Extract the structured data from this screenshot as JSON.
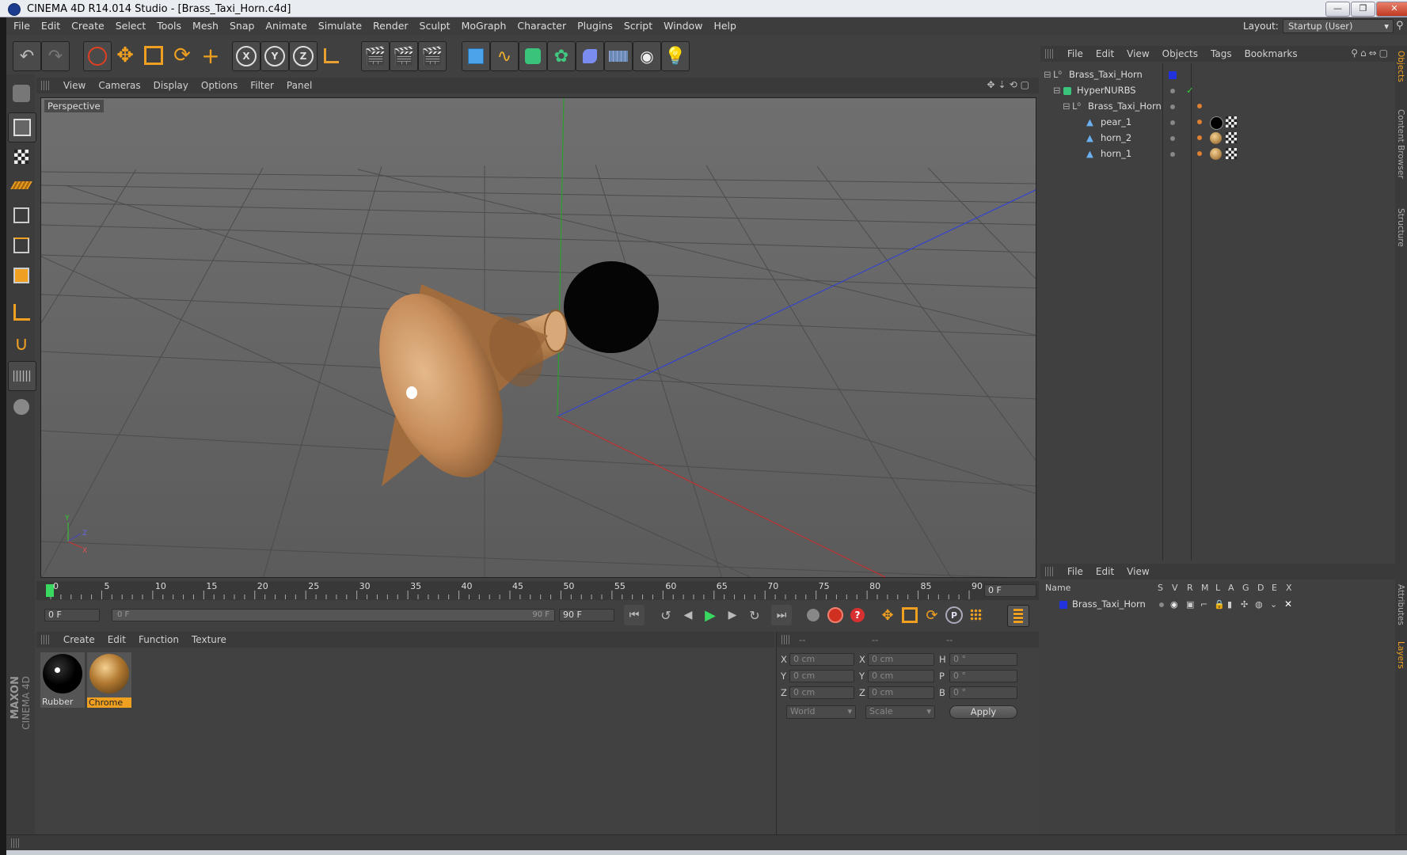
{
  "window": {
    "title": "CINEMA 4D R14.014 Studio - [Brass_Taxi_Horn.c4d]",
    "min": "—",
    "max": "❐",
    "close": "✕"
  },
  "menu": [
    "File",
    "Edit",
    "Create",
    "Select",
    "Tools",
    "Mesh",
    "Snap",
    "Animate",
    "Simulate",
    "Render",
    "Sculpt",
    "MoGraph",
    "Character",
    "Plugins",
    "Script",
    "Window",
    "Help"
  ],
  "layout": {
    "label": "Layout:",
    "value": "Startup (User)"
  },
  "viewport": {
    "menu": [
      "View",
      "Cameras",
      "Display",
      "Options",
      "Filter",
      "Panel"
    ],
    "label": "Perspective",
    "axes": {
      "y": "Y",
      "z": "Z",
      "x": "X"
    }
  },
  "objects": {
    "menu": [
      "File",
      "Edit",
      "View",
      "Objects",
      "Tags",
      "Bookmarks"
    ],
    "tree": [
      {
        "name": "Brass_Taxi_Horn",
        "level": 0
      },
      {
        "name": "HyperNURBS",
        "level": 1
      },
      {
        "name": "Brass_Taxi_Horn",
        "level": 2
      },
      {
        "name": "pear_1",
        "level": 3
      },
      {
        "name": "horn_2",
        "level": 3
      },
      {
        "name": "horn_1",
        "level": 3
      }
    ]
  },
  "side_tabs": {
    "right_top": [
      "Objects",
      "Content Browser",
      "Structure"
    ],
    "right_bottom": [
      "Attributes",
      "Layers"
    ]
  },
  "timeline": {
    "ticks": [
      "0",
      "5",
      "10",
      "15",
      "20",
      "25",
      "30",
      "35",
      "40",
      "45",
      "50",
      "55",
      "60",
      "65",
      "70",
      "75",
      "80",
      "85",
      "90"
    ],
    "current": "0 F",
    "start": "0 F",
    "slider_left": "0 F",
    "slider_right": "90 F",
    "end": "90 F"
  },
  "materials": {
    "menu": [
      "Create",
      "Edit",
      "Function",
      "Texture"
    ],
    "items": [
      {
        "name": "Rubber"
      },
      {
        "name": "Chrome"
      }
    ]
  },
  "coords": {
    "headers": [
      "--",
      "--",
      "--"
    ],
    "rows": [
      {
        "a": "X",
        "av": "0 cm",
        "b": "X",
        "bv": "0 cm",
        "c": "H",
        "cv": "0 °"
      },
      {
        "a": "Y",
        "av": "0 cm",
        "b": "Y",
        "bv": "0 cm",
        "c": "P",
        "cv": "0 °"
      },
      {
        "a": "Z",
        "av": "0 cm",
        "b": "Z",
        "bv": "0 cm",
        "c": "B",
        "cv": "0 °"
      }
    ],
    "mode1": "World",
    "mode2": "Scale",
    "apply": "Apply"
  },
  "layers": {
    "menu": [
      "File",
      "Edit",
      "View"
    ],
    "columns": [
      "Name",
      "S",
      "V",
      "R",
      "M",
      "L",
      "A",
      "G",
      "D",
      "E",
      "X"
    ],
    "rows": [
      {
        "name": "Brass_Taxi_Horn"
      }
    ]
  },
  "brand": {
    "line1": "MAXON",
    "line2": "CINEMA 4D"
  }
}
